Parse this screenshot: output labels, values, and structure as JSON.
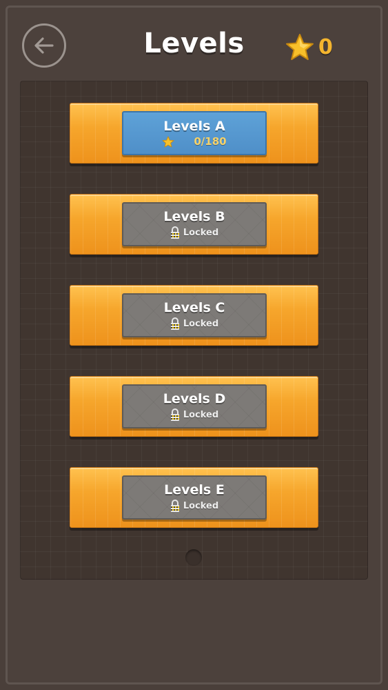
{
  "header": {
    "title": "Levels",
    "star_count": "0",
    "back_icon": "back-arrow-icon",
    "star_icon": "star-icon"
  },
  "colors": {
    "background": "#4a3f3a",
    "pack_orange": "#f3a126",
    "unlocked_blue": "#5ea2d8",
    "locked_gray": "#7d7a77",
    "star_gold": "#f4b52e"
  },
  "packs": [
    {
      "title": "Levels A",
      "status": "unlocked",
      "progress": "0/180"
    },
    {
      "title": "Levels B",
      "status": "locked",
      "locked_label": "Locked"
    },
    {
      "title": "Levels C",
      "status": "locked",
      "locked_label": "Locked"
    },
    {
      "title": "Levels D",
      "status": "locked",
      "locked_label": "Locked"
    },
    {
      "title": "Levels E",
      "status": "locked",
      "locked_label": "Locked"
    }
  ],
  "pager": {
    "current_page": 1,
    "total_pages": 1
  }
}
